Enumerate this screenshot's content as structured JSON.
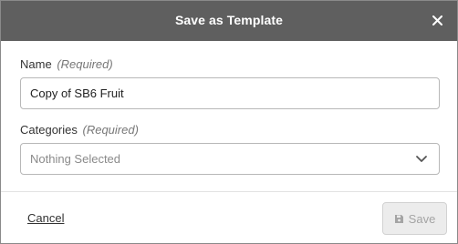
{
  "dialog": {
    "title": "Save as Template",
    "close_icon": "close-icon"
  },
  "form": {
    "name": {
      "label": "Name",
      "required_text": "(Required)",
      "value": "Copy of SB6 Fruit"
    },
    "categories": {
      "label": "Categories",
      "required_text": "(Required)",
      "selected": "Nothing Selected",
      "icon": "chevron-down-icon"
    }
  },
  "footer": {
    "cancel_label": "Cancel",
    "save_label": "Save",
    "save_icon": "save-icon",
    "save_disabled": true
  }
}
